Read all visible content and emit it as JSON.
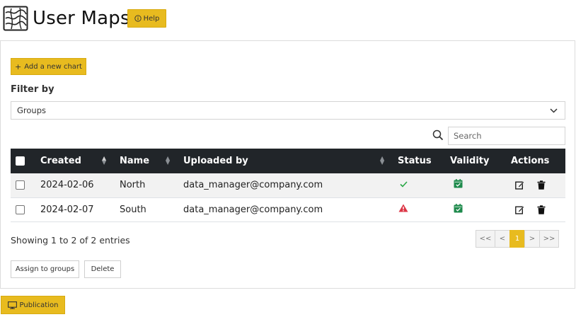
{
  "header": {
    "title": "User Maps",
    "help_label": "Help"
  },
  "toolbar": {
    "add_chart_label": "Add a new chart"
  },
  "filter": {
    "label": "Filter by",
    "groups_value": "Groups"
  },
  "search": {
    "placeholder": "Search"
  },
  "table": {
    "columns": [
      "Created",
      "Name",
      "Uploaded by",
      "Status",
      "Validity",
      "Actions"
    ],
    "rows": [
      {
        "created": "2024-02-06",
        "name": "North",
        "uploaded_by": "data_manager@company.com",
        "status": "ok",
        "validity": "valid"
      },
      {
        "created": "2024-02-07",
        "name": "South",
        "uploaded_by": "data_manager@company.com",
        "status": "warning",
        "validity": "valid"
      }
    ]
  },
  "footer": {
    "info": "Showing 1 to 2 of 2 entries",
    "pager": [
      "<<",
      "<",
      "1",
      ">",
      ">>"
    ],
    "assign_label": "Assign to groups",
    "delete_label": "Delete",
    "publication_label": "Publication"
  },
  "colors": {
    "accent": "#e8bb1f",
    "header_bg": "#212529",
    "status_ok": "#28a745",
    "status_warning": "#dc3545",
    "validity": "#1e8a4c"
  },
  "icons": [
    "map-logo-icon",
    "info-circle-icon",
    "plus-icon",
    "chevron-down-icon",
    "search-icon",
    "sort-icon",
    "check-icon",
    "warning-triangle-icon",
    "calendar-check-icon",
    "edit-icon",
    "trash-icon",
    "monitor-icon"
  ]
}
